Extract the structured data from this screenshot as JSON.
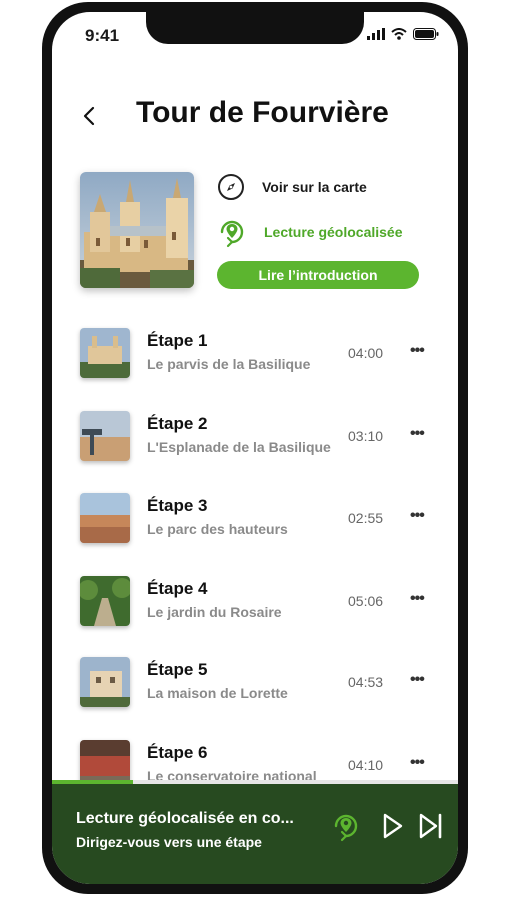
{
  "status_bar": {
    "time": "9:41"
  },
  "header": {
    "title": "Tour de Fourvière"
  },
  "actions": {
    "map_label": "Voir sur la carte",
    "geo_label": "Lecture géolocalisée",
    "intro_label": "Lire l’introduction"
  },
  "steps": [
    {
      "name": "Étape 1",
      "subtitle": "Le parvis de la Basilique",
      "duration": "04:00"
    },
    {
      "name": "Étape 2",
      "subtitle": "L'Esplanade de la Basilique",
      "duration": "03:10"
    },
    {
      "name": "Étape 3",
      "subtitle": "Le parc des hauteurs",
      "duration": "02:55"
    },
    {
      "name": "Étape 4",
      "subtitle": "Le jardin du Rosaire",
      "duration": "05:06"
    },
    {
      "name": "Étape 5",
      "subtitle": "La maison de Lorette",
      "duration": "04:53"
    },
    {
      "name": "Étape 6",
      "subtitle": "Le conservatoire national",
      "duration": "04:10"
    }
  ],
  "player": {
    "title": "Lecture géolocalisée en co...",
    "subtitle": "Dirigez-vous vers une étape",
    "progress": 0.2
  },
  "colors": {
    "accent": "#5cb52f",
    "player_bg": "#274a20"
  },
  "icons": [
    "back-chevron-icon",
    "compass-icon",
    "location-sync-icon",
    "more-dots-icon",
    "play-icon",
    "skip-next-icon"
  ]
}
